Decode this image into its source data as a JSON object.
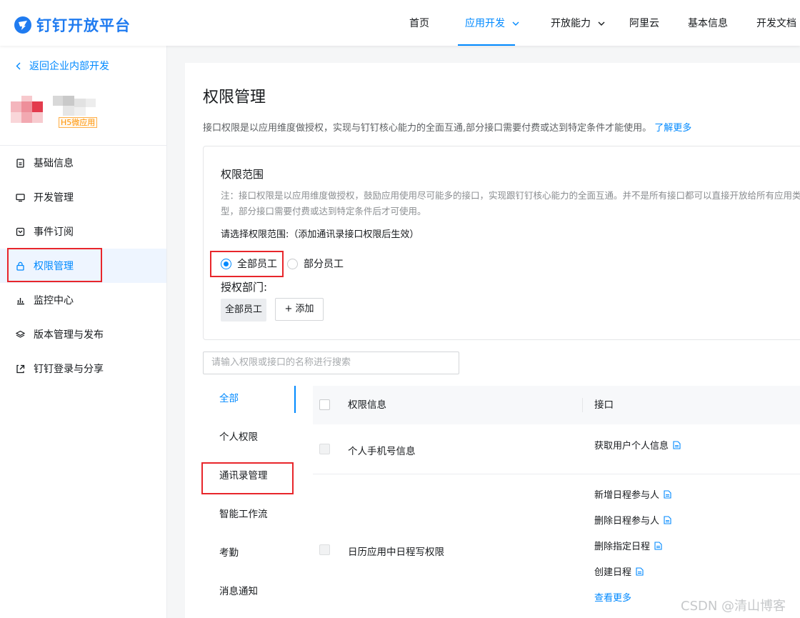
{
  "header": {
    "logo_text": "钉钉开放平台",
    "nav": [
      {
        "label": "首页",
        "active": false
      },
      {
        "label": "应用开发",
        "active": true,
        "dropdown": true
      },
      {
        "label": "开放能力",
        "active": false,
        "dropdown": true
      },
      {
        "label": "阿里云",
        "active": false
      },
      {
        "label": "基本信息",
        "active": false
      },
      {
        "label": "开发文档",
        "active": false
      }
    ]
  },
  "sidebar": {
    "back_label": "返回企业内部开发",
    "app_badge": "H5微应用",
    "items": [
      {
        "label": "基础信息",
        "icon": "document-icon"
      },
      {
        "label": "开发管理",
        "icon": "monitor-icon"
      },
      {
        "label": "事件订阅",
        "icon": "inbox-icon"
      },
      {
        "label": "权限管理",
        "icon": "lock-icon",
        "active": true
      },
      {
        "label": "监控中心",
        "icon": "bar-chart-icon"
      },
      {
        "label": "版本管理与发布",
        "icon": "layers-icon"
      },
      {
        "label": "钉钉登录与分享",
        "icon": "share-icon"
      }
    ]
  },
  "main": {
    "title": "权限管理",
    "description": "接口权限是以应用维度做授权，实现与钉钉核心能力的全面互通,部分接口需要付费或达到特定条件才能使用。",
    "learn_more": "了解更多",
    "scope": {
      "title": "权限范围",
      "note": "注：接口权限是以应用维度做授权，鼓励应用使用尽可能多的接口，实现跟钉钉核心能力的全面互通。并不是所有接口都可以直接开放给所有应用类型，部分接口需要付费或达到特定条件后才可使用。",
      "prompt": "请选择权限范围:（添加通讯录接口权限后生效）",
      "option_all": "全部员工",
      "option_partial": "部分员工",
      "selected": "全部员工",
      "dept_label": "授权部门:",
      "dept_tag": "全部员工",
      "add_label": "+ 添加"
    },
    "search_placeholder": "请输入权限或接口的名称进行搜索",
    "categories": [
      {
        "label": "全部",
        "active": true
      },
      {
        "label": "个人权限"
      },
      {
        "label": "通讯录管理"
      },
      {
        "label": "智能工作流"
      },
      {
        "label": "考勤"
      },
      {
        "label": "消息通知"
      }
    ],
    "table": {
      "col_permission": "权限信息",
      "col_api": "接口",
      "rows": [
        {
          "permission": "个人手机号信息",
          "apis": [
            "获取用户个人信息"
          ],
          "more": ""
        },
        {
          "permission": "日历应用中日程写权限",
          "apis": [
            "新增日程参与人",
            "删除日程参与人",
            "删除指定日程",
            "创建日程"
          ],
          "more": "查看更多"
        }
      ]
    }
  },
  "watermark": "CSDN @清山博客",
  "colors": {
    "accent": "#0089ff",
    "highlight": "#e8262b"
  }
}
